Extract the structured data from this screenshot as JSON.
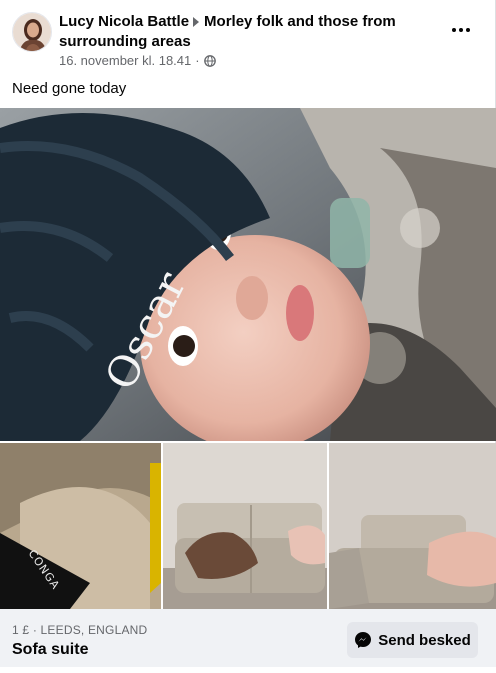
{
  "post": {
    "author": "Lucy Nicola Battle",
    "group": "Morley folk and those from surrounding areas",
    "timestamp": "16. november kl. 18.41",
    "privacy_icon": "globe-icon",
    "text": "Need gone today",
    "more_icon": "more-options-icon"
  },
  "photos": {
    "main": {
      "beanie_text": "Oscar"
    },
    "small_1": {
      "label": "CONGA"
    }
  },
  "listing": {
    "price_location": "1 £ · LEEDS, ENGLAND",
    "title": "Sofa suite",
    "send_button": "Send besked",
    "send_icon": "messenger-icon"
  },
  "colors": {
    "secondary_text": "#65676b",
    "footer_bg": "#f0f2f5",
    "button_bg": "#e4e6eb"
  }
}
